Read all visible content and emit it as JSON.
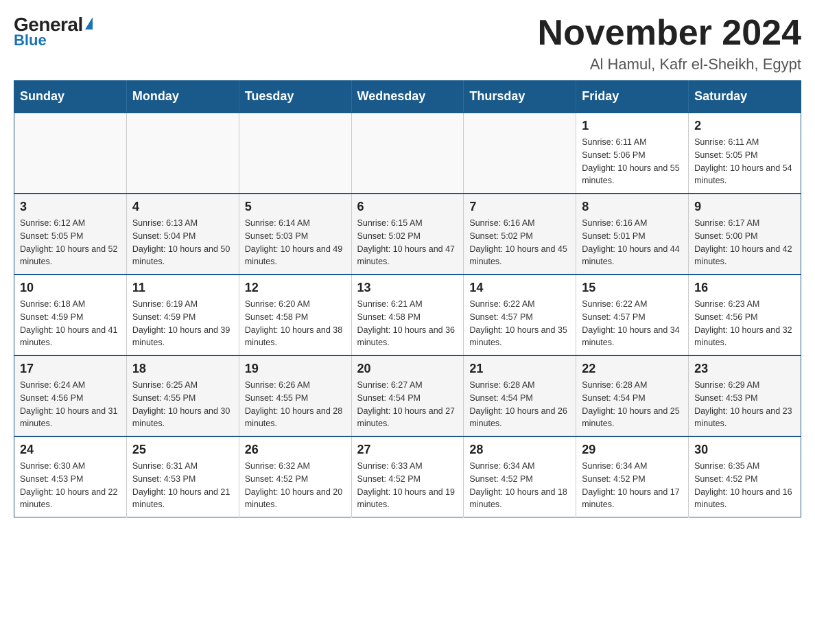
{
  "header": {
    "logo": {
      "general": "General",
      "triangle": "▶",
      "blue": "Blue"
    },
    "title": "November 2024",
    "location": "Al Hamul, Kafr el-Sheikh, Egypt"
  },
  "days_of_week": [
    "Sunday",
    "Monday",
    "Tuesday",
    "Wednesday",
    "Thursday",
    "Friday",
    "Saturday"
  ],
  "weeks": [
    {
      "days": [
        {
          "number": "",
          "info": ""
        },
        {
          "number": "",
          "info": ""
        },
        {
          "number": "",
          "info": ""
        },
        {
          "number": "",
          "info": ""
        },
        {
          "number": "",
          "info": ""
        },
        {
          "number": "1",
          "info": "Sunrise: 6:11 AM\nSunset: 5:06 PM\nDaylight: 10 hours and 55 minutes."
        },
        {
          "number": "2",
          "info": "Sunrise: 6:11 AM\nSunset: 5:05 PM\nDaylight: 10 hours and 54 minutes."
        }
      ]
    },
    {
      "days": [
        {
          "number": "3",
          "info": "Sunrise: 6:12 AM\nSunset: 5:05 PM\nDaylight: 10 hours and 52 minutes."
        },
        {
          "number": "4",
          "info": "Sunrise: 6:13 AM\nSunset: 5:04 PM\nDaylight: 10 hours and 50 minutes."
        },
        {
          "number": "5",
          "info": "Sunrise: 6:14 AM\nSunset: 5:03 PM\nDaylight: 10 hours and 49 minutes."
        },
        {
          "number": "6",
          "info": "Sunrise: 6:15 AM\nSunset: 5:02 PM\nDaylight: 10 hours and 47 minutes."
        },
        {
          "number": "7",
          "info": "Sunrise: 6:16 AM\nSunset: 5:02 PM\nDaylight: 10 hours and 45 minutes."
        },
        {
          "number": "8",
          "info": "Sunrise: 6:16 AM\nSunset: 5:01 PM\nDaylight: 10 hours and 44 minutes."
        },
        {
          "number": "9",
          "info": "Sunrise: 6:17 AM\nSunset: 5:00 PM\nDaylight: 10 hours and 42 minutes."
        }
      ]
    },
    {
      "days": [
        {
          "number": "10",
          "info": "Sunrise: 6:18 AM\nSunset: 4:59 PM\nDaylight: 10 hours and 41 minutes."
        },
        {
          "number": "11",
          "info": "Sunrise: 6:19 AM\nSunset: 4:59 PM\nDaylight: 10 hours and 39 minutes."
        },
        {
          "number": "12",
          "info": "Sunrise: 6:20 AM\nSunset: 4:58 PM\nDaylight: 10 hours and 38 minutes."
        },
        {
          "number": "13",
          "info": "Sunrise: 6:21 AM\nSunset: 4:58 PM\nDaylight: 10 hours and 36 minutes."
        },
        {
          "number": "14",
          "info": "Sunrise: 6:22 AM\nSunset: 4:57 PM\nDaylight: 10 hours and 35 minutes."
        },
        {
          "number": "15",
          "info": "Sunrise: 6:22 AM\nSunset: 4:57 PM\nDaylight: 10 hours and 34 minutes."
        },
        {
          "number": "16",
          "info": "Sunrise: 6:23 AM\nSunset: 4:56 PM\nDaylight: 10 hours and 32 minutes."
        }
      ]
    },
    {
      "days": [
        {
          "number": "17",
          "info": "Sunrise: 6:24 AM\nSunset: 4:56 PM\nDaylight: 10 hours and 31 minutes."
        },
        {
          "number": "18",
          "info": "Sunrise: 6:25 AM\nSunset: 4:55 PM\nDaylight: 10 hours and 30 minutes."
        },
        {
          "number": "19",
          "info": "Sunrise: 6:26 AM\nSunset: 4:55 PM\nDaylight: 10 hours and 28 minutes."
        },
        {
          "number": "20",
          "info": "Sunrise: 6:27 AM\nSunset: 4:54 PM\nDaylight: 10 hours and 27 minutes."
        },
        {
          "number": "21",
          "info": "Sunrise: 6:28 AM\nSunset: 4:54 PM\nDaylight: 10 hours and 26 minutes."
        },
        {
          "number": "22",
          "info": "Sunrise: 6:28 AM\nSunset: 4:54 PM\nDaylight: 10 hours and 25 minutes."
        },
        {
          "number": "23",
          "info": "Sunrise: 6:29 AM\nSunset: 4:53 PM\nDaylight: 10 hours and 23 minutes."
        }
      ]
    },
    {
      "days": [
        {
          "number": "24",
          "info": "Sunrise: 6:30 AM\nSunset: 4:53 PM\nDaylight: 10 hours and 22 minutes."
        },
        {
          "number": "25",
          "info": "Sunrise: 6:31 AM\nSunset: 4:53 PM\nDaylight: 10 hours and 21 minutes."
        },
        {
          "number": "26",
          "info": "Sunrise: 6:32 AM\nSunset: 4:52 PM\nDaylight: 10 hours and 20 minutes."
        },
        {
          "number": "27",
          "info": "Sunrise: 6:33 AM\nSunset: 4:52 PM\nDaylight: 10 hours and 19 minutes."
        },
        {
          "number": "28",
          "info": "Sunrise: 6:34 AM\nSunset: 4:52 PM\nDaylight: 10 hours and 18 minutes."
        },
        {
          "number": "29",
          "info": "Sunrise: 6:34 AM\nSunset: 4:52 PM\nDaylight: 10 hours and 17 minutes."
        },
        {
          "number": "30",
          "info": "Sunrise: 6:35 AM\nSunset: 4:52 PM\nDaylight: 10 hours and 16 minutes."
        }
      ]
    }
  ]
}
